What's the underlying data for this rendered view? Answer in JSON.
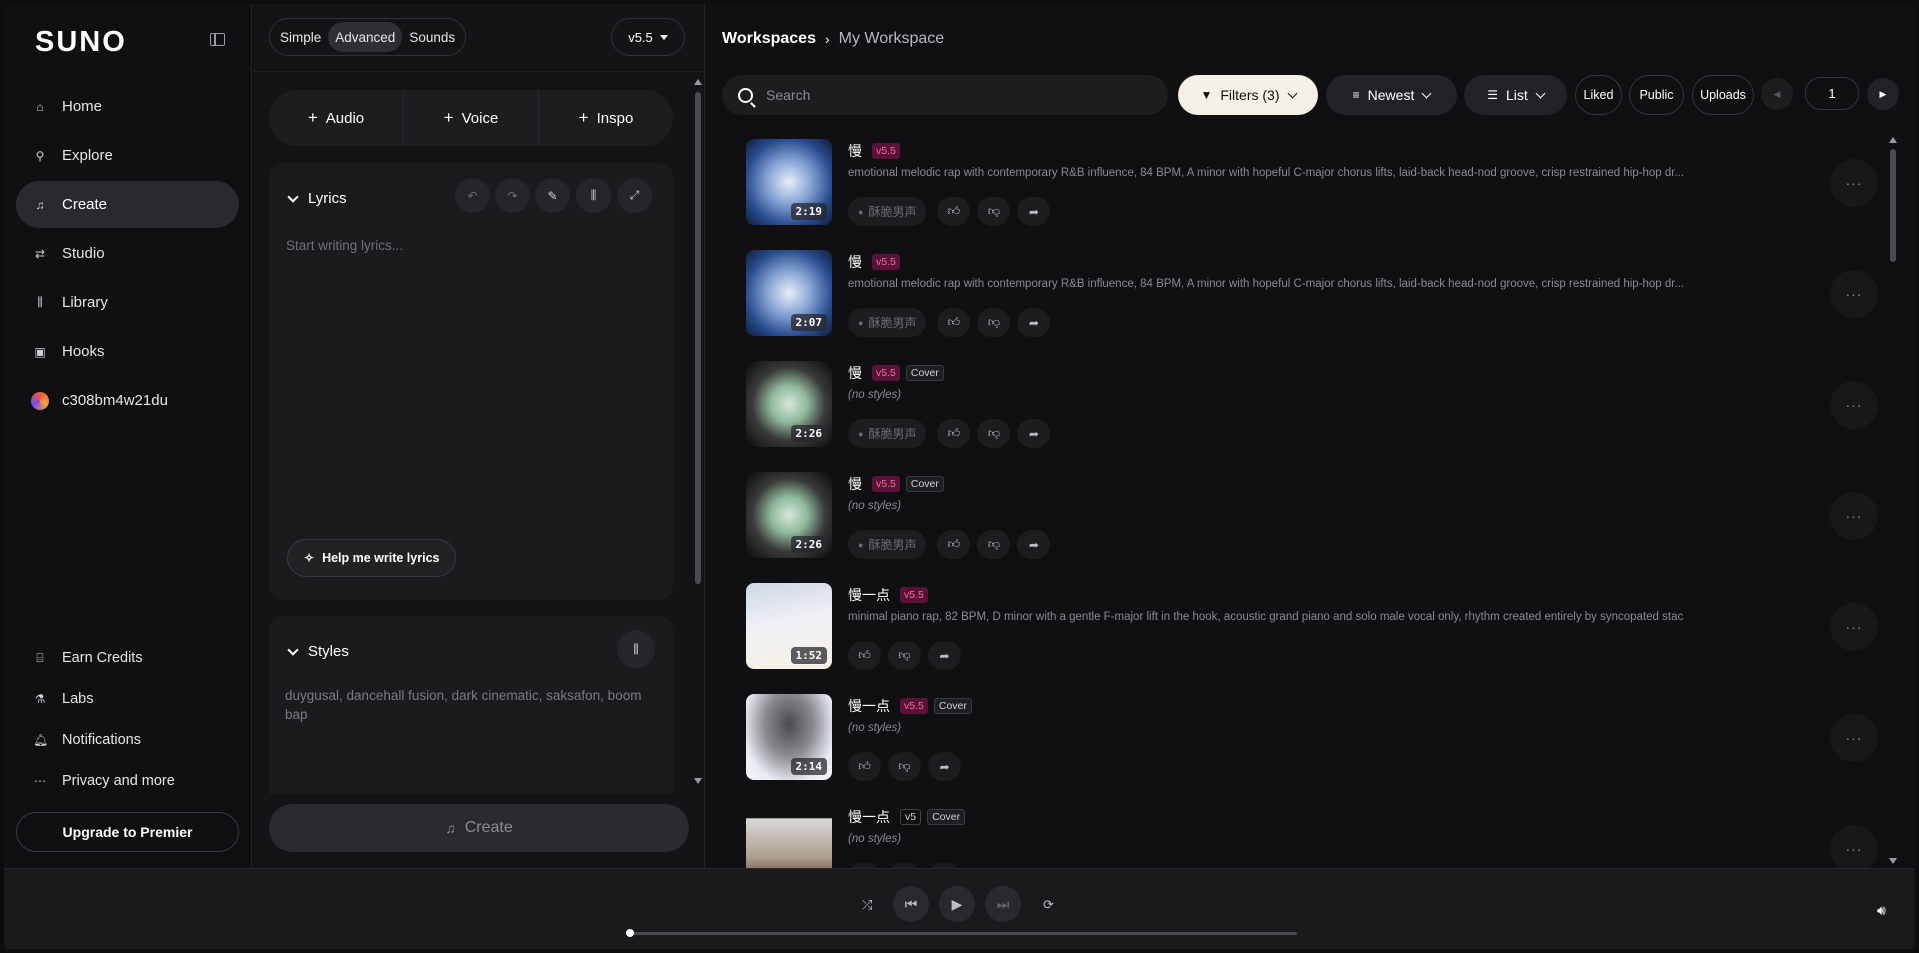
{
  "sidebar": {
    "logo": "SUNO",
    "nav": [
      {
        "label": "Home",
        "icon": "home-icon"
      },
      {
        "label": "Explore",
        "icon": "search-icon"
      },
      {
        "label": "Create",
        "icon": "music-note-icon",
        "active": true
      },
      {
        "label": "Studio",
        "icon": "studio-icon"
      },
      {
        "label": "Library",
        "icon": "library-icon"
      },
      {
        "label": "Hooks",
        "icon": "hooks-icon"
      },
      {
        "label": "c308bm4w21du",
        "icon": "avatar"
      }
    ],
    "bottom": [
      {
        "label": "Earn Credits",
        "icon": "gift-icon"
      },
      {
        "label": "Labs",
        "icon": "flask-icon"
      },
      {
        "label": "Notifications",
        "icon": "bell-icon"
      },
      {
        "label": "Privacy and more",
        "icon": "more-icon"
      }
    ],
    "upgrade_label": "Upgrade to Premier"
  },
  "create_panel": {
    "modes": [
      "Simple",
      "Advanced",
      "Sounds"
    ],
    "active_mode": "Advanced",
    "version": "v5.5",
    "add_buttons": [
      "Audio",
      "Voice",
      "Inspo"
    ],
    "lyrics": {
      "title": "Lyrics",
      "placeholder": "Start writing lyrics...",
      "help_label": "Help me write lyrics"
    },
    "styles": {
      "title": "Styles",
      "value": "duygusal, dancehall fusion, dark cinematic, saksafon, boom bap"
    },
    "create_label": "Create"
  },
  "workspace": {
    "breadcrumb": [
      "Workspaces",
      "My Workspace"
    ],
    "search_placeholder": "Search",
    "filters_label": "Filters (3)",
    "sort_label": "Newest",
    "view_label": "List",
    "quick_filters": [
      "Liked",
      "Public",
      "Uploads"
    ],
    "page": "1",
    "songs": [
      {
        "title": "慢",
        "version": "v5.5",
        "cover": "",
        "desc": "emotional melodic rap with contemporary R&B influence, 84 BPM, A minor with hopeful C-major chorus lifts, laid-back head-nod groove, crisp restrained hip-hop dr...",
        "duration": "2:19",
        "voice": "酥脆男声",
        "art": "hourglass-blue"
      },
      {
        "title": "慢",
        "version": "v5.5",
        "cover": "",
        "desc": "emotional melodic rap with contemporary R&B influence, 84 BPM, A minor with hopeful C-major chorus lifts, laid-back head-nod groove, crisp restrained hip-hop dr...",
        "duration": "2:07",
        "voice": "酥脆男声",
        "art": "hourglass-blue"
      },
      {
        "title": "慢",
        "version": "v5.5",
        "cover": "Cover",
        "desc": "(no styles)",
        "duration": "2:26",
        "voice": "酥脆男声",
        "art": "hourglass-green"
      },
      {
        "title": "慢",
        "version": "v5.5",
        "cover": "Cover",
        "desc": "(no styles)",
        "duration": "2:26",
        "voice": "酥脆男声",
        "art": "hourglass-green"
      },
      {
        "title": "慢一点",
        "version": "v5.5",
        "cover": "",
        "desc": "minimal piano rap, 82 BPM, D minor with a gentle F-major lift in the hook, acoustic grand piano and solo male vocal only, rhythm created entirely by syncopated stac...",
        "duration": "1:52",
        "voice": "",
        "art": "sketch-house"
      },
      {
        "title": "慢一点",
        "version": "v5.5",
        "cover": "Cover",
        "desc": "(no styles)",
        "duration": "2:14",
        "voice": "",
        "art": "sketch-storm"
      },
      {
        "title": "慢一点",
        "version": "v5",
        "cover": "Cover",
        "desc": "(no styles)",
        "duration": "",
        "voice": "",
        "art": "photo-dark"
      }
    ]
  },
  "colors": {
    "accent_tag_bg": "#5a1236",
    "accent_tag_text": "#f06ba4",
    "filters_bg": "#f4f0e8",
    "active_nav": "#2a2a2e"
  }
}
